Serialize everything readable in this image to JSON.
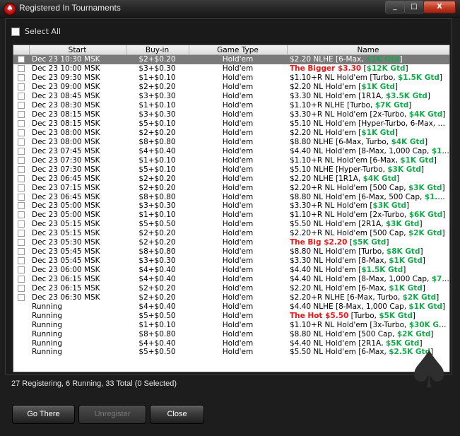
{
  "window": {
    "title": "Registered In Tournaments",
    "controls": [
      "_",
      "□",
      "X"
    ]
  },
  "select_all": {
    "label": "Select All",
    "checked": false
  },
  "columns": [
    "",
    "Start",
    "Buy-in",
    "Game Type",
    "Name"
  ],
  "rows": [
    {
      "start": "Dec 23  10:30 MSK",
      "buyin": "$2+$0.20",
      "game": "Hold'em",
      "name": [
        {
          "t": "$2.20 NLHE [6-Max, "
        },
        {
          "t": "$1K Gtd",
          "c": "grn"
        },
        {
          "t": "]"
        }
      ],
      "selected": true,
      "checkbox": true
    },
    {
      "start": "Dec 23  10:00 MSK",
      "buyin": "$3+$0.30",
      "game": "Hold'em",
      "name": [
        {
          "t": "The Bigger $3.30",
          "c": "red"
        },
        {
          "t": " ["
        },
        {
          "t": "$12K Gtd",
          "c": "grn"
        },
        {
          "t": "]"
        }
      ],
      "checkbox": true
    },
    {
      "start": "Dec 23  09:30 MSK",
      "buyin": "$1+$0.10",
      "game": "Hold'em",
      "name": [
        {
          "t": "$1.10+R NL Hold'em [Turbo, "
        },
        {
          "t": "$1.5K Gtd",
          "c": "grn"
        },
        {
          "t": "]"
        }
      ],
      "checkbox": true
    },
    {
      "start": "Dec 23  09:00 MSK",
      "buyin": "$2+$0.20",
      "game": "Hold'em",
      "name": [
        {
          "t": "$2.20 NL Hold'em ["
        },
        {
          "t": "$1K Gtd",
          "c": "grn"
        },
        {
          "t": "]"
        }
      ],
      "checkbox": true
    },
    {
      "start": "Dec 23  08:45 MSK",
      "buyin": "$3+$0.30",
      "game": "Hold'em",
      "name": [
        {
          "t": "$3.30 NL Hold'em [1R1A, "
        },
        {
          "t": "$3.5K Gtd",
          "c": "grn"
        },
        {
          "t": "]"
        }
      ],
      "checkbox": true
    },
    {
      "start": "Dec 23  08:30 MSK",
      "buyin": "$1+$0.10",
      "game": "Hold'em",
      "name": [
        {
          "t": "$1.10+R NLHE [Turbo, "
        },
        {
          "t": "$7K Gtd",
          "c": "grn"
        },
        {
          "t": "]"
        }
      ],
      "checkbox": true
    },
    {
      "start": "Dec 23  08:15 MSK",
      "buyin": "$3+$0.30",
      "game": "Hold'em",
      "name": [
        {
          "t": "$3.30+R NL Hold'em [2x-Turbo, "
        },
        {
          "t": "$4K Gtd",
          "c": "grn"
        },
        {
          "t": "]"
        }
      ],
      "checkbox": true
    },
    {
      "start": "Dec 23  08:15 MSK",
      "buyin": "$5+$0.10",
      "game": "Hold'em",
      "name": [
        {
          "t": "$5.10 NL Hold'em [Hyper-Turbo, 6-Max, "
        },
        {
          "t": "$1...",
          "c": "grn"
        }
      ],
      "checkbox": true
    },
    {
      "start": "Dec 23  08:00 MSK",
      "buyin": "$2+$0.20",
      "game": "Hold'em",
      "name": [
        {
          "t": "$2.20 NL Hold'em ["
        },
        {
          "t": "$1K Gtd",
          "c": "grn"
        },
        {
          "t": "]"
        }
      ],
      "checkbox": true
    },
    {
      "start": "Dec 23  08:00 MSK",
      "buyin": "$8+$0.80",
      "game": "Hold'em",
      "name": [
        {
          "t": "$8.80 NLHE [6-Max, Turbo, "
        },
        {
          "t": "$4K Gtd",
          "c": "grn"
        },
        {
          "t": "]"
        }
      ],
      "checkbox": true
    },
    {
      "start": "Dec 23  07:45 MSK",
      "buyin": "$4+$0.40",
      "game": "Hold'em",
      "name": [
        {
          "t": "$4.40 NL Hold'em [8-Max, 1,000 Cap, "
        },
        {
          "t": "$1K ...",
          "c": "grn"
        }
      ],
      "checkbox": true
    },
    {
      "start": "Dec 23  07:30 MSK",
      "buyin": "$1+$0.10",
      "game": "Hold'em",
      "name": [
        {
          "t": "$1.10+R NL Hold'em [6-Max, "
        },
        {
          "t": "$1K Gtd",
          "c": "grn"
        },
        {
          "t": "]"
        }
      ],
      "checkbox": true
    },
    {
      "start": "Dec 23  07:30 MSK",
      "buyin": "$5+$0.10",
      "game": "Hold'em",
      "name": [
        {
          "t": "$5.10 NLHE [Hyper-Turbo, "
        },
        {
          "t": "$3K Gtd",
          "c": "grn"
        },
        {
          "t": "]"
        }
      ],
      "checkbox": true
    },
    {
      "start": "Dec 23  06:45 MSK",
      "buyin": "$2+$0.20",
      "game": "Hold'em",
      "name": [
        {
          "t": "$2.20 NLHE [1R1A, "
        },
        {
          "t": "$4K Gtd",
          "c": "grn"
        },
        {
          "t": "]"
        }
      ],
      "checkbox": true
    },
    {
      "start": "Dec 23  07:15 MSK",
      "buyin": "$2+$0.20",
      "game": "Hold'em",
      "name": [
        {
          "t": "$2.20+R NL Hold'em [500 Cap, "
        },
        {
          "t": "$3K Gtd",
          "c": "grn"
        },
        {
          "t": "]"
        }
      ],
      "checkbox": true
    },
    {
      "start": "Dec 23  06:45 MSK",
      "buyin": "$8+$0.80",
      "game": "Hold'em",
      "name": [
        {
          "t": "$8.80 NL Hold'em [6-Max, 500 Cap, "
        },
        {
          "t": "$1.5K ...",
          "c": "grn"
        }
      ],
      "checkbox": true
    },
    {
      "start": "Dec 23  05:00 MSK",
      "buyin": "$3+$0.30",
      "game": "Hold'em",
      "name": [
        {
          "t": "$3.30+R NL Hold'em ["
        },
        {
          "t": "$3K Gtd",
          "c": "grn"
        },
        {
          "t": "]"
        }
      ],
      "checkbox": true
    },
    {
      "start": "Dec 23  05:00 MSK",
      "buyin": "$1+$0.10",
      "game": "Hold'em",
      "name": [
        {
          "t": "$1.10+R NL Hold'em [2x-Turbo, "
        },
        {
          "t": "$6K Gtd",
          "c": "grn"
        },
        {
          "t": "]"
        }
      ],
      "checkbox": true
    },
    {
      "start": "Dec 23  05:15 MSK",
      "buyin": "$5+$0.50",
      "game": "Hold'em",
      "name": [
        {
          "t": "$5.50 NL Hold'em [2R1A, "
        },
        {
          "t": "$3K Gtd",
          "c": "grn"
        },
        {
          "t": "]"
        }
      ],
      "checkbox": true
    },
    {
      "start": "Dec 23  05:15 MSK",
      "buyin": "$2+$0.20",
      "game": "Hold'em",
      "name": [
        {
          "t": "$2.20+R NL Hold'em [500 Cap, "
        },
        {
          "t": "$2K Gtd",
          "c": "grn"
        },
        {
          "t": "]"
        }
      ],
      "checkbox": true
    },
    {
      "start": "Dec 23  05:30 MSK",
      "buyin": "$2+$0.20",
      "game": "Hold'em",
      "name": [
        {
          "t": "The Big $2.20",
          "c": "red"
        },
        {
          "t": " ["
        },
        {
          "t": "$5K Gtd",
          "c": "grn"
        },
        {
          "t": "]"
        }
      ],
      "checkbox": true
    },
    {
      "start": "Dec 23  05:45 MSK",
      "buyin": "$8+$0.80",
      "game": "Hold'em",
      "name": [
        {
          "t": "$8.80 NL Hold'em [Turbo, "
        },
        {
          "t": "$8K Gtd",
          "c": "grn"
        },
        {
          "t": "]"
        }
      ],
      "checkbox": true
    },
    {
      "start": "Dec 23  05:45 MSK",
      "buyin": "$3+$0.30",
      "game": "Hold'em",
      "name": [
        {
          "t": "$3.30 NL Hold'em [8-Max, "
        },
        {
          "t": "$1K Gtd",
          "c": "grn"
        },
        {
          "t": "]"
        }
      ],
      "checkbox": true
    },
    {
      "start": "Dec 23  06:00 MSK",
      "buyin": "$4+$0.40",
      "game": "Hold'em",
      "name": [
        {
          "t": "$4.40 NL Hold'em ["
        },
        {
          "t": "$1.5K Gtd",
          "c": "grn"
        },
        {
          "t": "]"
        }
      ],
      "checkbox": true
    },
    {
      "start": "Dec 23  06:15 MSK",
      "buyin": "$4+$0.40",
      "game": "Hold'em",
      "name": [
        {
          "t": "$4.40 NL Hold'em [8-Max, 1,000 Cap, "
        },
        {
          "t": "$750 ...",
          "c": "grn"
        }
      ],
      "checkbox": true
    },
    {
      "start": "Dec 23  06:15 MSK",
      "buyin": "$2+$0.20",
      "game": "Hold'em",
      "name": [
        {
          "t": "$2.20 NL Hold'em [6-Max, "
        },
        {
          "t": "$1K Gtd",
          "c": "grn"
        },
        {
          "t": "]"
        }
      ],
      "checkbox": true
    },
    {
      "start": "Dec 23  06:30 MSK",
      "buyin": "$2+$0.20",
      "game": "Hold'em",
      "name": [
        {
          "t": "$2.20+R NLHE [6-Max, Turbo, "
        },
        {
          "t": "$2K Gtd",
          "c": "grn"
        },
        {
          "t": "]"
        }
      ],
      "checkbox": true
    },
    {
      "start": "Running",
      "buyin": "$4+$0.40",
      "game": "Hold'em",
      "name": [
        {
          "t": "$4.40 NLHE [8-Max, 1,000 Cap, "
        },
        {
          "t": "$1K Gtd",
          "c": "grn"
        },
        {
          "t": "]"
        }
      ],
      "checkbox": false
    },
    {
      "start": "Running",
      "buyin": "$5+$0.50",
      "game": "Hold'em",
      "name": [
        {
          "t": "The Hot $5.50",
          "c": "red"
        },
        {
          "t": " [Turbo, "
        },
        {
          "t": "$5K Gtd",
          "c": "grn"
        },
        {
          "t": "]"
        }
      ],
      "checkbox": false
    },
    {
      "start": "Running",
      "buyin": "$1+$0.10",
      "game": "Hold'em",
      "name": [
        {
          "t": "$1.10+R NL Hold'em [3x-Turbo, "
        },
        {
          "t": "$30K Gtd",
          "c": "grn"
        },
        {
          "t": "]"
        }
      ],
      "checkbox": false
    },
    {
      "start": "Running",
      "buyin": "$8+$0.80",
      "game": "Hold'em",
      "name": [
        {
          "t": "$8.80 NL Hold'em [500 Cap, "
        },
        {
          "t": "$2K Gtd",
          "c": "grn"
        },
        {
          "t": "]"
        }
      ],
      "checkbox": false
    },
    {
      "start": "Running",
      "buyin": "$4+$0.40",
      "game": "Hold'em",
      "name": [
        {
          "t": "$4.40 NL Hold'em [2R1A, "
        },
        {
          "t": "$5K Gtd",
          "c": "grn"
        },
        {
          "t": "]"
        }
      ],
      "checkbox": false
    },
    {
      "start": "Running",
      "buyin": "$5+$0.50",
      "game": "Hold'em",
      "name": [
        {
          "t": "$5.50 NL Hold'em [6-Max, "
        },
        {
          "t": "$2.5K Gtd",
          "c": "grn"
        },
        {
          "t": "]"
        }
      ],
      "checkbox": false
    }
  ],
  "status": "27 Registering, 6 Running, 33 Total (0 Selected)",
  "buttons": {
    "go_there": "Go There",
    "unregister": "Unregister",
    "close": "Close"
  },
  "colors": {
    "accent_red": "#e21b1b",
    "guarantee_green": "#17a84c",
    "selected_row": "#7a7a7a"
  }
}
